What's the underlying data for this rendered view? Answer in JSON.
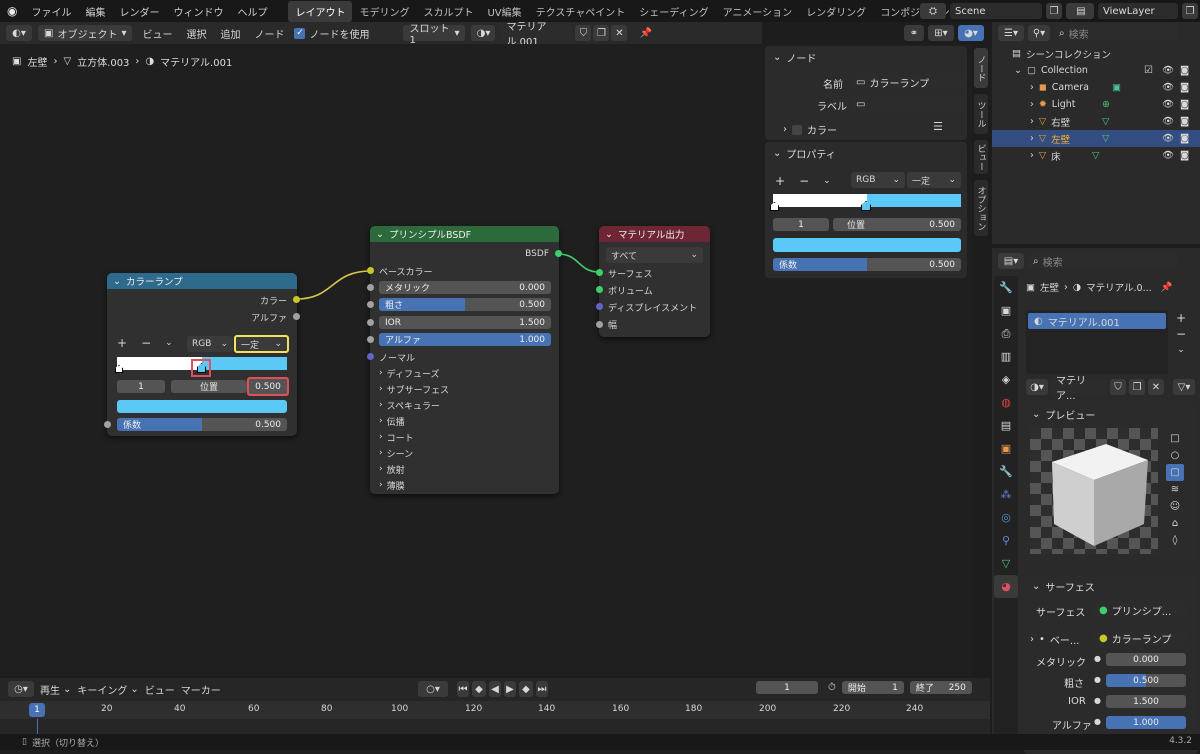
{
  "topbar": {
    "menus": [
      "ファイル",
      "編集",
      "レンダー",
      "ウィンドウ",
      "ヘルプ"
    ],
    "workspaces": [
      "レイアウト",
      "モデリング",
      "スカルプト",
      "UV編集",
      "テクスチャペイント",
      "シェーディング",
      "アニメーション",
      "レンダリング",
      "コンポジティング"
    ],
    "active_workspace": "レイアウト",
    "scene": "Scene",
    "view_layer": "ViewLayer"
  },
  "node_header": {
    "mode": "オブジェクト",
    "menus": [
      "ビュー",
      "選択",
      "追加",
      "ノード"
    ],
    "use_nodes": "ノードを使用",
    "slot": "スロット1",
    "material": "マテリアル.001"
  },
  "breadcrumb": [
    "左壁",
    "立方体.003",
    "マテリアル.001"
  ],
  "node_colorramp": {
    "title": "カラーランプ",
    "out_color": "カラー",
    "out_alpha": "アルファ",
    "plus": "+",
    "minus": "−",
    "color_mode": "RGB",
    "interpolation": "一定",
    "stop_index": "1",
    "pos_label": "位置",
    "pos_value": "0.500",
    "fac_label": "係数",
    "fac_value": "0.500",
    "fac": 0.5,
    "stop_color": "#5bc8f5"
  },
  "node_bsdf": {
    "title": "プリンシプルBSDF",
    "output": "BSDF",
    "base_color": "ベースカラー",
    "metallic_label": "メタリック",
    "metallic_value": "0.000",
    "roughness_label": "粗さ",
    "roughness_value": "0.500",
    "ior_label": "IOR",
    "ior_value": "1.500",
    "alpha_label": "アルファ",
    "alpha_value": "1.000",
    "normal": "ノーマル",
    "sections": [
      "ディフューズ",
      "サブサーフェス",
      "スペキュラー",
      "伝播",
      "コート",
      "シーン",
      "放射",
      "薄膜"
    ]
  },
  "node_output": {
    "title": "マテリアル出力",
    "target": "すべて",
    "inputs": [
      "サーフェス",
      "ボリューム",
      "ディスプレイスメント",
      "幅"
    ]
  },
  "npanel": {
    "node_section": "ノード",
    "name_label": "名前",
    "name_value": "カラーランプ",
    "label_label": "ラベル",
    "label_value": "",
    "color_label": "カラー",
    "props_section": "プロパティ",
    "plus": "+",
    "minus": "−",
    "color_mode": "RGB",
    "interpolation": "一定",
    "stop_index": "1",
    "pos_label": "位置",
    "pos_value": "0.500",
    "fac_label": "係数",
    "fac_value": "0.500",
    "tabs": [
      "ノード",
      "ツール",
      "ビュー",
      "オプション"
    ]
  },
  "outliner": {
    "search_placeholder": "検索",
    "collection": "シーンコレクション",
    "sub_collection": "Collection",
    "items": [
      "Camera",
      "Light",
      "右壁",
      "左壁",
      "床"
    ]
  },
  "properties": {
    "search_placeholder": "検索",
    "breadcrumb_obj": "左壁",
    "breadcrumb_mat": "マテリアル.0...",
    "slot_item": "マテリアル.001",
    "material_name": "マテリア...",
    "preview_section": "プレビュー",
    "surface_section": "サーフェス",
    "surface_label": "サーフェス",
    "surface_value": "プリンシプ...",
    "base_label": "ベー...",
    "base_value": "カラーランプ",
    "metallic_label": "メタリック",
    "metallic_value": "0.000",
    "roughness_label": "粗さ",
    "roughness_value": "0.500",
    "ior_label": "IOR",
    "ior_value": "1.500",
    "alpha_label": "アルファ",
    "alpha_value": "1.000"
  },
  "timeline": {
    "menus": [
      "再生",
      "キーイング",
      "ビュー",
      "マーカー"
    ],
    "current_frame": "1",
    "start_label": "開始",
    "start": "1",
    "end_label": "終了",
    "end": "250",
    "ticks": [
      "1",
      "20",
      "40",
      "60",
      "80",
      "100",
      "120",
      "140",
      "160",
      "180",
      "200",
      "220",
      "240"
    ]
  },
  "status": {
    "left": "選択（切り替え）",
    "version": "4.3.2"
  }
}
